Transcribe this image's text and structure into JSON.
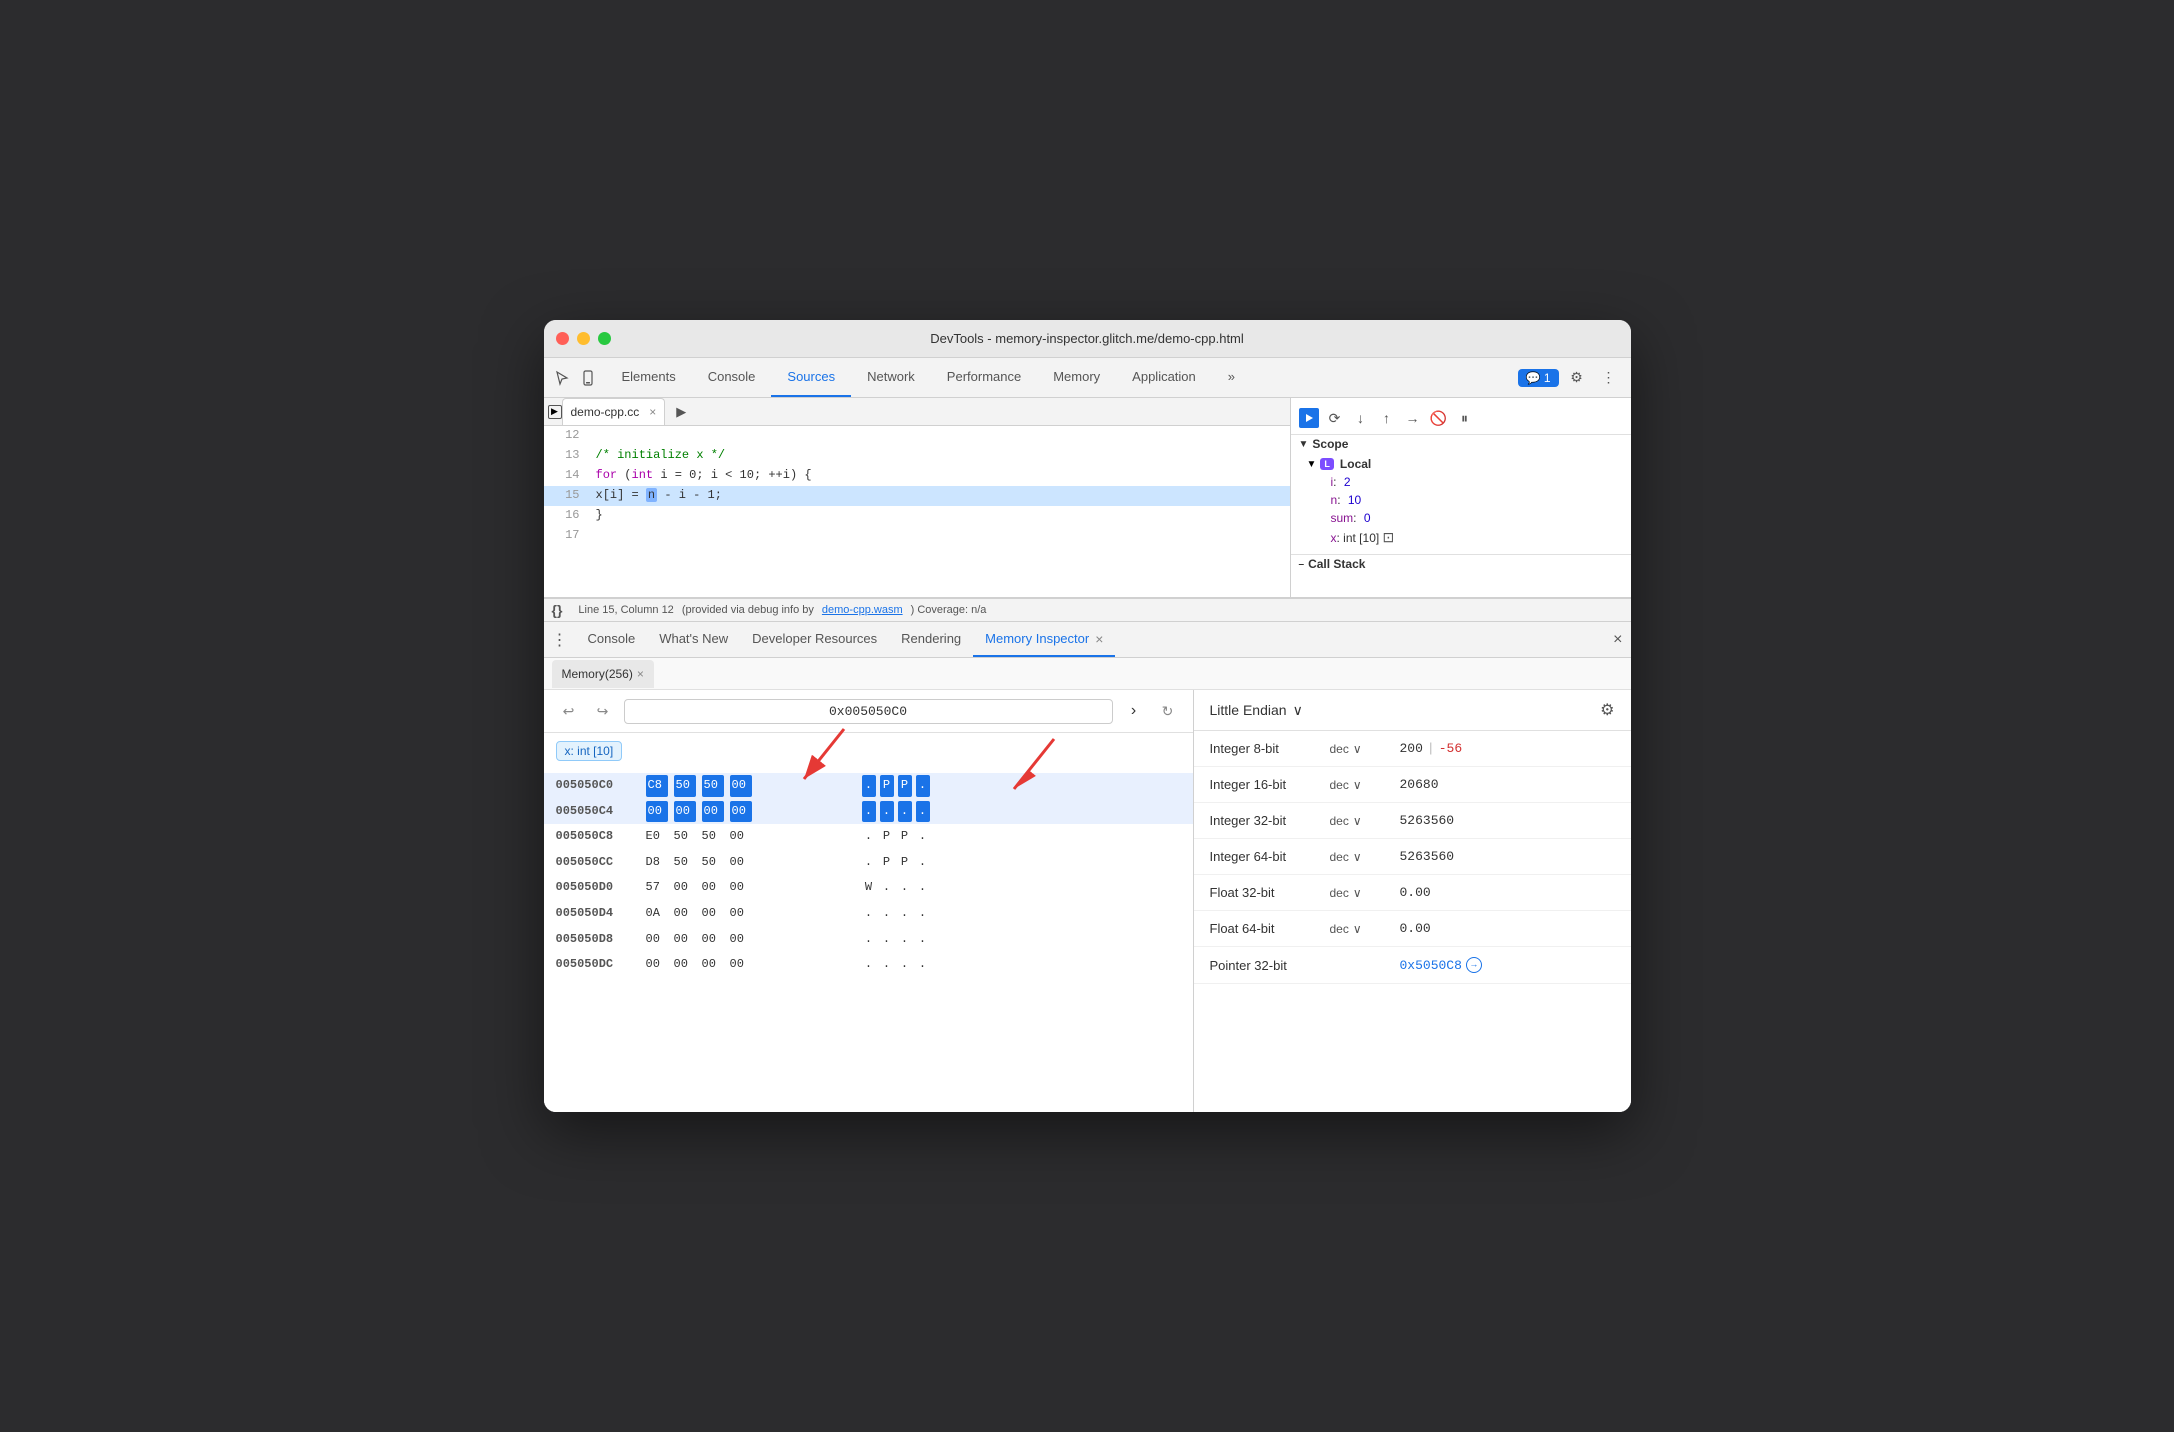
{
  "window": {
    "title": "DevTools - memory-inspector.glitch.me/demo-cpp.html"
  },
  "devtools": {
    "tabs": [
      {
        "label": "Elements",
        "active": false
      },
      {
        "label": "Console",
        "active": false
      },
      {
        "label": "Sources",
        "active": true
      },
      {
        "label": "Network",
        "active": false
      },
      {
        "label": "Performance",
        "active": false
      },
      {
        "label": "Memory",
        "active": false
      },
      {
        "label": "Application",
        "active": false
      }
    ],
    "more_icon": "»",
    "chat_badge": "1",
    "settings_icon": "⚙",
    "more_vert": "⋮"
  },
  "source_panel": {
    "tab_label": "demo-cpp.cc",
    "tab_close": "×",
    "code_lines": [
      {
        "num": "12",
        "content": ""
      },
      {
        "num": "13",
        "content": "  /* initialize x */"
      },
      {
        "num": "14",
        "content": "  for (int i = 0; i < 10; ++i) {"
      },
      {
        "num": "15",
        "content": "    x[i] = n - i - 1;",
        "highlighted": true
      },
      {
        "num": "16",
        "content": "  }"
      },
      {
        "num": "17",
        "content": ""
      }
    ]
  },
  "scope_panel": {
    "header": "Scope",
    "local_badge": "L",
    "local_label": "Local",
    "vars": [
      {
        "name": "i",
        "sep": ":",
        "val": "2"
      },
      {
        "name": "n",
        "sep": ":",
        "val": "10"
      },
      {
        "name": "sum",
        "sep": ":",
        "val": "0"
      },
      {
        "name": "x",
        "sep": ":",
        "val": "int [10]"
      }
    ],
    "call_stack_label": "Call Stack"
  },
  "status_bar": {
    "braces": "{}",
    "position": "Line 15, Column 12",
    "debug_info": "(provided via debug info by",
    "debug_link": "demo-cpp.wasm",
    "coverage": ") Coverage: n/a"
  },
  "drawer": {
    "tabs": [
      {
        "label": "Console",
        "active": false
      },
      {
        "label": "What's New",
        "active": false
      },
      {
        "label": "Developer Resources",
        "active": false
      },
      {
        "label": "Rendering",
        "active": false
      },
      {
        "label": "Memory Inspector",
        "active": true,
        "closeable": true
      }
    ],
    "close_icon": "×"
  },
  "memory_panel": {
    "sub_tab_label": "Memory(256)",
    "sub_tab_close": "×",
    "back_icon": "↩",
    "forward_icon": "↪",
    "address": "0x005050C0",
    "nav_right": "›",
    "refresh_icon": "↻",
    "var_chip": "x: int [10]",
    "hex_rows": [
      {
        "addr": "005050C0",
        "bytes": [
          "C8",
          "50",
          "50",
          "00"
        ],
        "ascii": [
          ".",
          "P",
          "P",
          "."
        ],
        "highlighted": true,
        "bytes_selected": [
          0,
          1,
          2,
          3
        ],
        "ascii_selected": [
          0,
          1,
          2,
          3
        ]
      },
      {
        "addr": "005050C4",
        "bytes": [
          "00",
          "00",
          "00",
          "00"
        ],
        "ascii": [
          ".",
          ".",
          ".",
          "."
        ],
        "highlighted": true,
        "bytes_selected": [
          0,
          1,
          2,
          3
        ],
        "ascii_selected": [
          0,
          1,
          2,
          3
        ]
      },
      {
        "addr": "005050C8",
        "bytes": [
          "E0",
          "50",
          "50",
          "00"
        ],
        "ascii": [
          ".",
          "P",
          "P",
          "."
        ],
        "highlighted": false
      },
      {
        "addr": "005050CC",
        "bytes": [
          "D8",
          "50",
          "50",
          "00"
        ],
        "ascii": [
          ".",
          "P",
          "P",
          "."
        ],
        "highlighted": false
      },
      {
        "addr": "005050D0",
        "bytes": [
          "57",
          "00",
          "00",
          "00"
        ],
        "ascii": [
          "W",
          ".",
          ".",
          "."
        ],
        "highlighted": false
      },
      {
        "addr": "005050D4",
        "bytes": [
          "0A",
          "00",
          "00",
          "00"
        ],
        "ascii": [
          ".",
          ".",
          ".",
          "."
        ],
        "highlighted": false
      },
      {
        "addr": "005050D8",
        "bytes": [
          "00",
          "00",
          "00",
          "00"
        ],
        "ascii": [
          ".",
          ".",
          ".",
          "."
        ],
        "highlighted": false
      },
      {
        "addr": "005050DC",
        "bytes": [
          "00",
          "00",
          "00",
          "00"
        ],
        "ascii": [
          ".",
          ".",
          ".",
          "."
        ],
        "highlighted": false
      }
    ]
  },
  "data_inspector": {
    "endian_label": "Little Endian",
    "endian_icon": "∨",
    "settings_icon": "⚙",
    "rows": [
      {
        "type": "Integer 8-bit",
        "format": "dec",
        "value_main": "200",
        "value_sep": "|",
        "value_alt": "-56"
      },
      {
        "type": "Integer 16-bit",
        "format": "dec",
        "value_main": "20680"
      },
      {
        "type": "Integer 32-bit",
        "format": "dec",
        "value_main": "5263560"
      },
      {
        "type": "Integer 64-bit",
        "format": "dec",
        "value_main": "5263560"
      },
      {
        "type": "Float 32-bit",
        "format": "dec",
        "value_main": "0.00"
      },
      {
        "type": "Float 64-bit",
        "format": "dec",
        "value_main": "0.00"
      },
      {
        "type": "Pointer 32-bit",
        "format": "",
        "value_main": "0x5050C8",
        "is_pointer": true
      }
    ]
  }
}
